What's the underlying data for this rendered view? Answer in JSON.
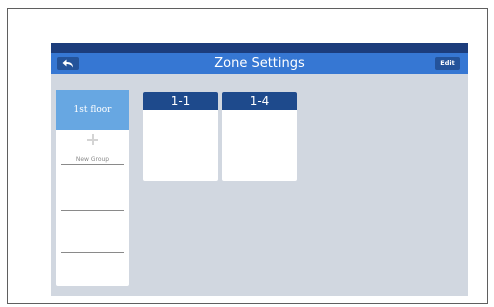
{
  "header": {
    "title": "Zone Settings",
    "back_icon": "back-arrow-icon",
    "edit_label": "Edit"
  },
  "sidebar": {
    "floor_label": "1st floor",
    "new_group_label": "New Group",
    "add_icon": "plus-icon"
  },
  "zones": [
    {
      "label": "1-1"
    },
    {
      "label": "1-4"
    }
  ],
  "colors": {
    "top_strip": "#1c3d7c",
    "title_bar": "#3677d3",
    "button": "#24539a",
    "floor_tab": "#67a7e2",
    "zone_header": "#1e4a8c",
    "screen_background": "#d1d7e0"
  }
}
